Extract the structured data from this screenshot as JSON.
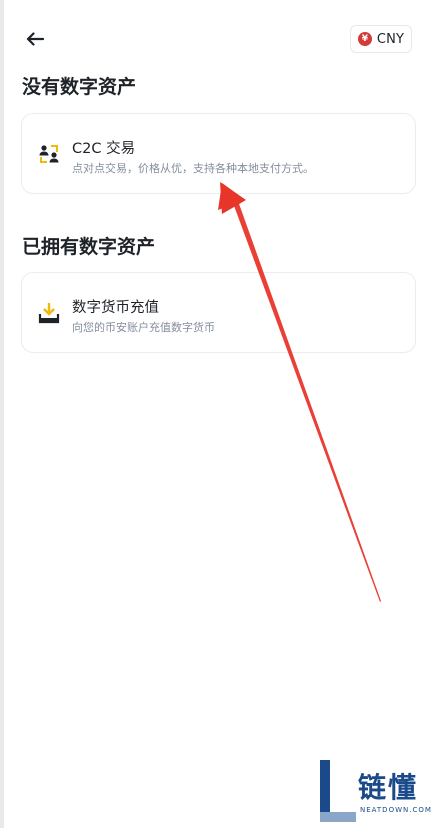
{
  "header": {
    "back_icon": "arrow-left-icon",
    "currency": {
      "symbol": "¥",
      "label": "CNY",
      "color": "#d33a3a"
    }
  },
  "sections": [
    {
      "title": "没有数字资产",
      "card": {
        "icon": "c2c-users-icon",
        "title": "C2C 交易",
        "description": "点对点交易，价格从优，支持各种本地支付方式。"
      }
    },
    {
      "title": "已拥有数字资产",
      "card": {
        "icon": "deposit-download-icon",
        "title": "数字货币充值",
        "description": "向您的币安账户充值数字货币"
      }
    }
  ],
  "annotation": {
    "color": "#e8352a"
  },
  "watermark": {
    "text": "链懂",
    "subtitle": "NEATDOWN.COM"
  }
}
